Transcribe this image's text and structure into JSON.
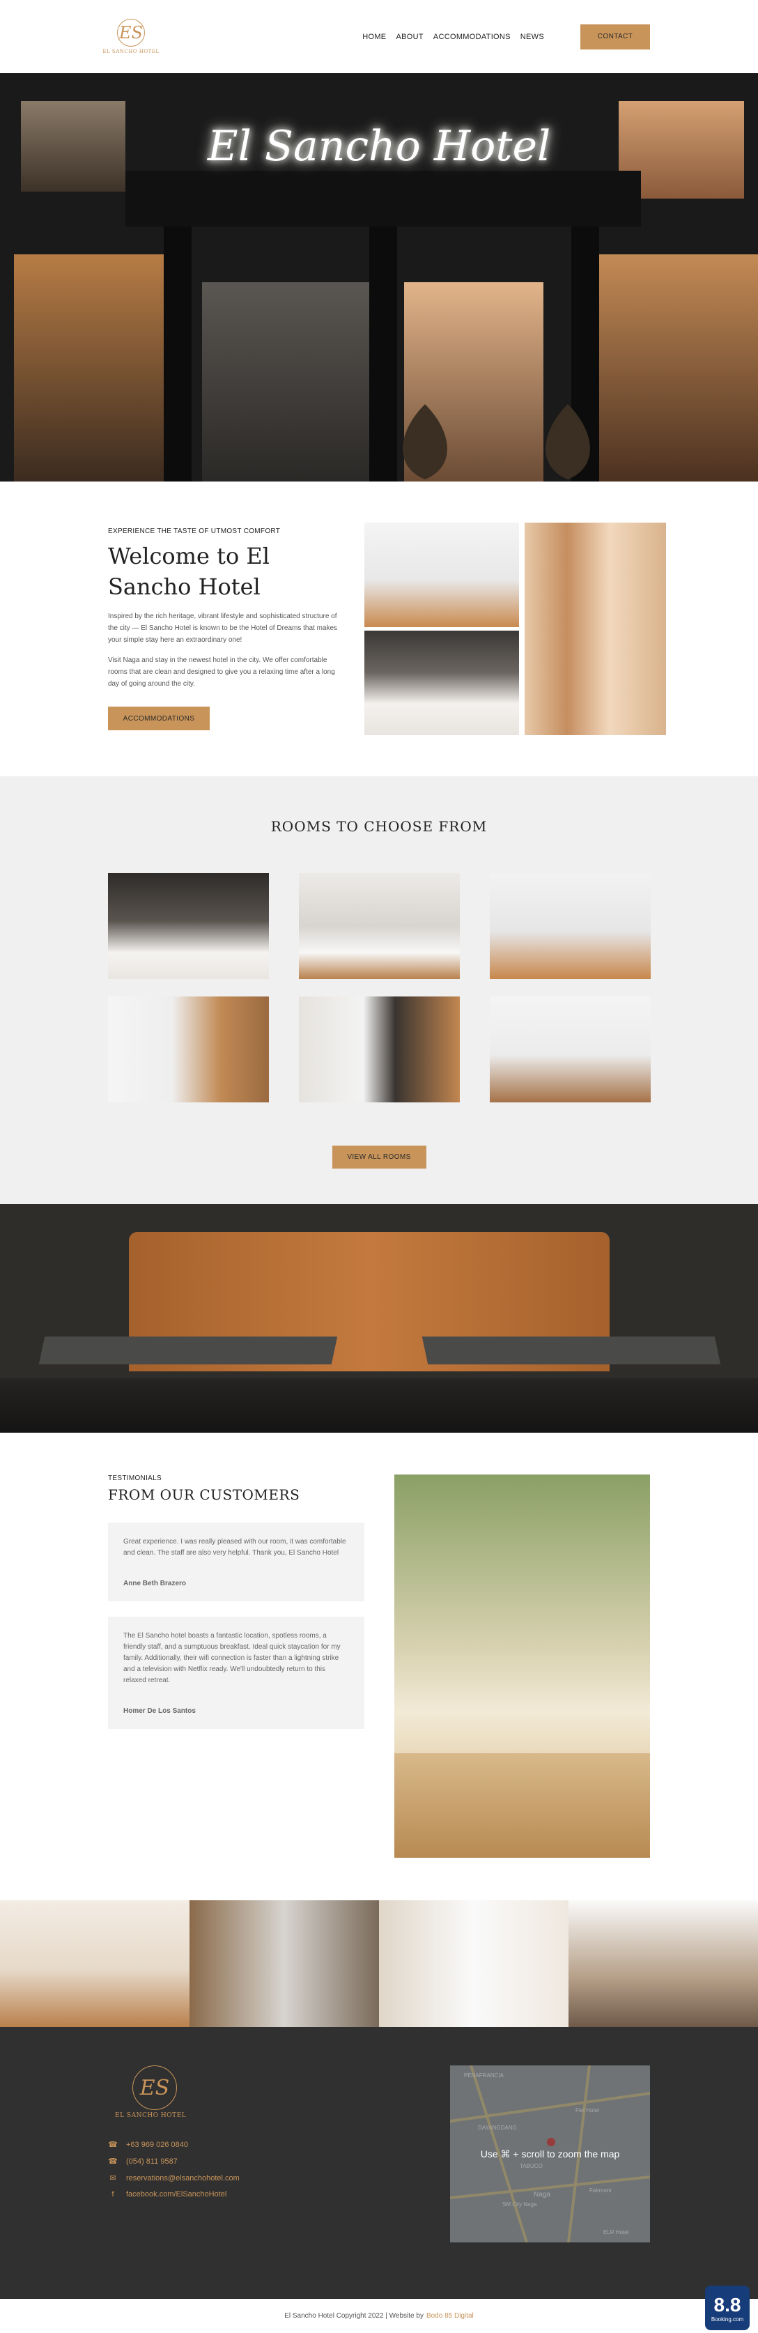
{
  "header": {
    "logo_monogram": "ES",
    "logo_name": "EL SANCHO HOTEL",
    "nav": [
      "HOME",
      "ABOUT",
      "ACCOMMODATIONS",
      "NEWS"
    ],
    "contact_label": "CONTACT"
  },
  "hero": {
    "sign_text": "El Sancho Hotel"
  },
  "welcome": {
    "eyebrow": "EXPERIENCE THE TASTE OF UTMOST COMFORT",
    "title": "Welcome to El Sancho Hotel",
    "paragraph1": "Inspired by the rich heritage, vibrant lifestyle and sophisticated structure of the city — El Sancho Hotel is known to be the Hotel of Dreams that makes your simple stay here an extraordinary one!",
    "paragraph2": "Visit Naga and stay in the newest hotel in the city. We offer comfortable rooms that are clean and designed to give you a relaxing time after a long day of going around the city.",
    "button_label": "ACCOMMODATIONS"
  },
  "rooms": {
    "title": "ROOMS TO CHOOSE FROM",
    "button_label": "VIEW ALL ROOMS"
  },
  "testimonials": {
    "eyebrow": "TESTIMONIALS",
    "title": "FROM OUR CUSTOMERS",
    "items": [
      {
        "text": "Great experience. I was really pleased with our room, it was comfortable and clean. The staff are also very helpful. Thank you, El Sancho Hotel",
        "author": "Anne Beth Brazero"
      },
      {
        "text": "The El Sancho hotel boasts a fantastic location, spotless rooms, a friendly staff, and a sumptuous breakfast. Ideal quick staycation for my family. Additionally, their wifi connection is faster than a lightning strike and a television with Netflix ready. We'll undoubtedly return to this relaxed retreat.",
        "author": "Homer De Los Santos"
      }
    ]
  },
  "footer": {
    "logo_monogram": "ES",
    "logo_name": "EL SANCHO HOTEL",
    "phone1": "+63 969 026 0840",
    "phone2": "(054) 811 9587",
    "email": "reservations@elsanchohotel.com",
    "facebook": "facebook.com/ElSanchoHotel",
    "map_hint": "Use ⌘ + scroll to zoom the map",
    "map_labels": [
      "PENAFRANCIA",
      "DAYANGDANG",
      "Naga",
      "SM City Naga",
      "TABUCO",
      "Fiel Hotel",
      "Fairmont",
      "ELR Hotel"
    ]
  },
  "copyright": {
    "text": "El Sancho Hotel Copyright 2022  | Website by",
    "link": "Bodo 85 Digital"
  },
  "booking": {
    "score": "8.8",
    "name": "Booking.com"
  },
  "colors": {
    "accent": "#c8945a",
    "footer_bg": "#303030",
    "rooms_bg": "#f0f0f0"
  }
}
